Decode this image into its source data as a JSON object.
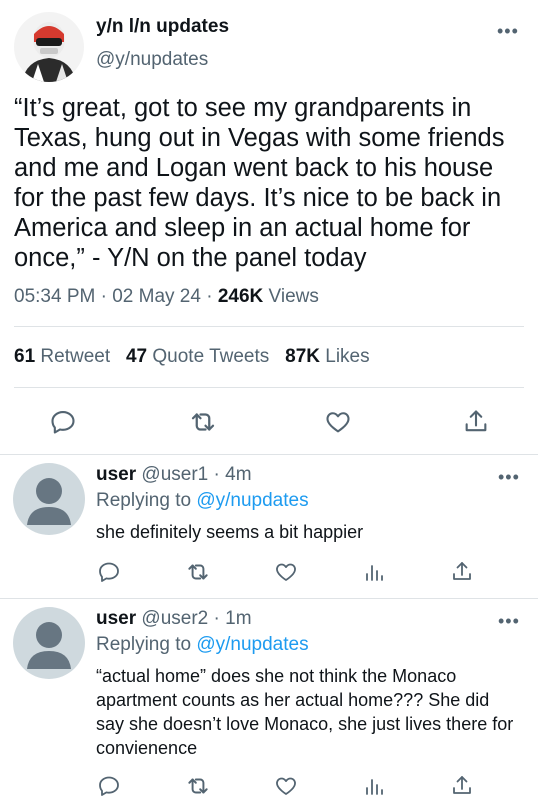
{
  "main_tweet": {
    "author_name": "y/n l/n updates",
    "author_handle": "@y/nupdates",
    "more_icon": "more-icon",
    "text": "“It’s great, got to see my grandparents in Texas, hung out in Vegas with some friends and me and Logan went back to his house for the past few days. It’s nice to be back in America and sleep in an actual home for once,” - Y/N on the panel today",
    "time": "05:34 PM",
    "date": "02 May 24",
    "sep": "·",
    "views_count": "246K",
    "views_label": "Views",
    "retweets_count": "61",
    "retweets_label": "Retweet",
    "quotes_count": "47",
    "quotes_label": "Quote Tweets",
    "likes_count": "87K",
    "likes_label": "Likes",
    "actions": [
      "reply-icon",
      "retweet-icon",
      "like-icon",
      "share-icon"
    ]
  },
  "replies": [
    {
      "name": "user",
      "handle": "@user1",
      "sep": "·",
      "time": "4m",
      "replying_label": "Replying to",
      "replying_to": "@y/nupdates",
      "text": "she definitely seems a bit happier"
    },
    {
      "name": "user",
      "handle": "@user2",
      "sep": "·",
      "time": "1m",
      "replying_label": "Replying to",
      "replying_to": "@y/nupdates",
      "text": "“actual home” does she not think the Monaco apartment counts as her actual home??? She did say she doesn’t love Monaco, she just lives there for convienence"
    }
  ],
  "colors": {
    "accent": "#1d9bf0",
    "muted": "#536471",
    "divider": "#dfe3e6",
    "avatar_placeholder": "#cfd9de"
  }
}
